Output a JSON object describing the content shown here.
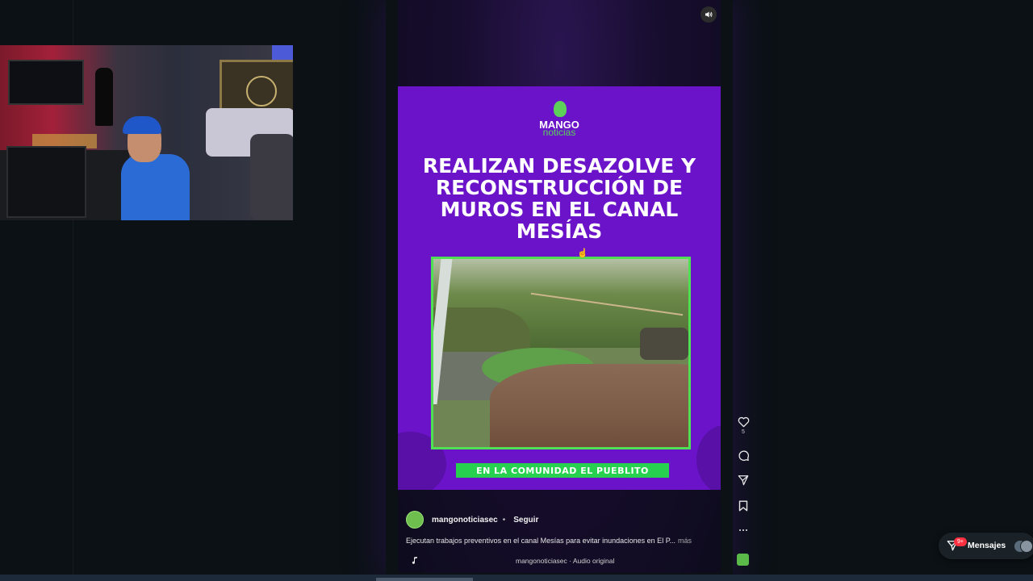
{
  "reel": {
    "sound_icon": "speaker-icon",
    "post": {
      "brand_line1": "MANGO",
      "brand_line2": "noticias",
      "headline": "REALIZAN DESAZOLVE Y RECONSTRUCCIÓN DE MUROS EN EL CANAL MESÍAS",
      "banner": "EN LA COMUNIDAD EL PUEBLITO"
    },
    "author": {
      "username": "mangonoticiasec",
      "separator": "•",
      "follow_label": "Seguir"
    },
    "caption": "Ejecutan trabajos preventivos en el canal Mesías para evitar inundaciones en El P...",
    "caption_more": "más",
    "audio": {
      "icon": "music-note-icon",
      "text": "mangonoticiasec · Audio original"
    },
    "actions": {
      "like_icon": "heart-icon",
      "like_count": "5",
      "comment_icon": "comment-icon",
      "share_icon": "send-icon",
      "save_icon": "bookmark-icon",
      "more_icon": "more-icon"
    }
  },
  "messages": {
    "badge": "9+",
    "label": "Mensajes"
  },
  "colors": {
    "post_bg": "#6a13c8",
    "accent_green": "#27d04f",
    "badge_red": "#ff3040"
  }
}
